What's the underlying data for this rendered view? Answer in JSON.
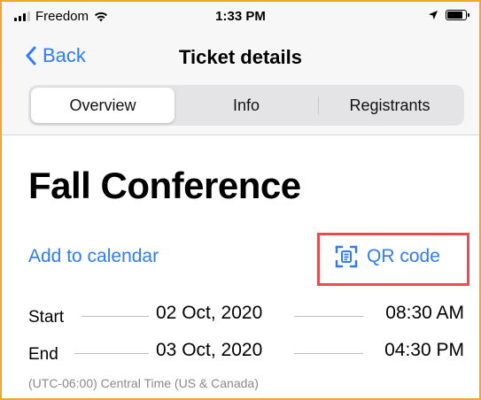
{
  "status_bar": {
    "carrier": "Freedom",
    "time": "1:33 PM",
    "battery_level": 0.85
  },
  "nav": {
    "back_label": "Back",
    "title": "Ticket details"
  },
  "tabs": [
    {
      "label": "Overview",
      "selected": true
    },
    {
      "label": "Info",
      "selected": false
    },
    {
      "label": "Registrants",
      "selected": false
    }
  ],
  "event": {
    "title": "Fall Conference",
    "add_to_calendar_label": "Add to calendar",
    "qr_code_label": "QR code",
    "start": {
      "label": "Start",
      "date": "02 Oct, 2020",
      "time": "08:30 AM"
    },
    "end": {
      "label": "End",
      "date": "03 Oct, 2020",
      "time": "04:30 PM"
    },
    "timezone": "(UTC-06:00) Central Time (US & Canada)"
  },
  "colors": {
    "accent": "#2f7cf6",
    "highlight": "#e54e50",
    "frame": "#f4a62a"
  },
  "icons": {
    "back": "chevron-left-icon",
    "qr": "qr-code-icon",
    "wifi": "wifi-icon",
    "location": "location-arrow-icon",
    "battery": "battery-icon",
    "signal": "signal-icon"
  }
}
